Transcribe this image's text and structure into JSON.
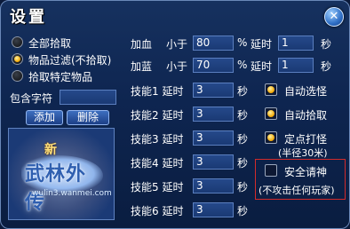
{
  "window": {
    "title": "设置",
    "close_glyph": "✕"
  },
  "filter": {
    "options": [
      {
        "label": "全部拾取",
        "checked": false
      },
      {
        "label": "物品过滤(不拾取)",
        "checked": true
      },
      {
        "label": "拾取特定物品",
        "checked": false
      }
    ],
    "contains_label": "包含字符",
    "contains_value": "",
    "add_label": "添加",
    "delete_label": "删除",
    "logo_text": {
      "new": "新",
      "name": "武林外传",
      "url": "wulin3.wanmei.com"
    }
  },
  "recover": {
    "hp": {
      "label": "加血",
      "cond": "小于",
      "value": "80",
      "unit": "%",
      "delay_label": "延时",
      "delay_value": "1",
      "delay_unit": "秒"
    },
    "mp": {
      "label": "加蓝",
      "cond": "小于",
      "value": "70",
      "unit": "%",
      "delay_label": "延时",
      "delay_value": "1",
      "delay_unit": "秒"
    }
  },
  "skills": [
    {
      "label": "技能1 延时",
      "value": "3",
      "unit": "秒"
    },
    {
      "label": "技能2 延时",
      "value": "3",
      "unit": "秒"
    },
    {
      "label": "技能3 延时",
      "value": "3",
      "unit": "秒"
    },
    {
      "label": "技能4 延时",
      "value": "3",
      "unit": "秒"
    },
    {
      "label": "技能5 延时",
      "value": "3",
      "unit": "秒"
    },
    {
      "label": "技能6 延时",
      "value": "3",
      "unit": "秒"
    }
  ],
  "options": {
    "auto_select": {
      "label": "自动选怪",
      "checked": true
    },
    "auto_pickup": {
      "label": "自动拾取",
      "checked": true
    },
    "fixed_point": {
      "label": "定点打怪",
      "sub": "(半径30米)",
      "checked": true
    },
    "safe_mode": {
      "label": "安全请神",
      "sub": "(不攻击任何玩家)",
      "checked": false
    }
  }
}
